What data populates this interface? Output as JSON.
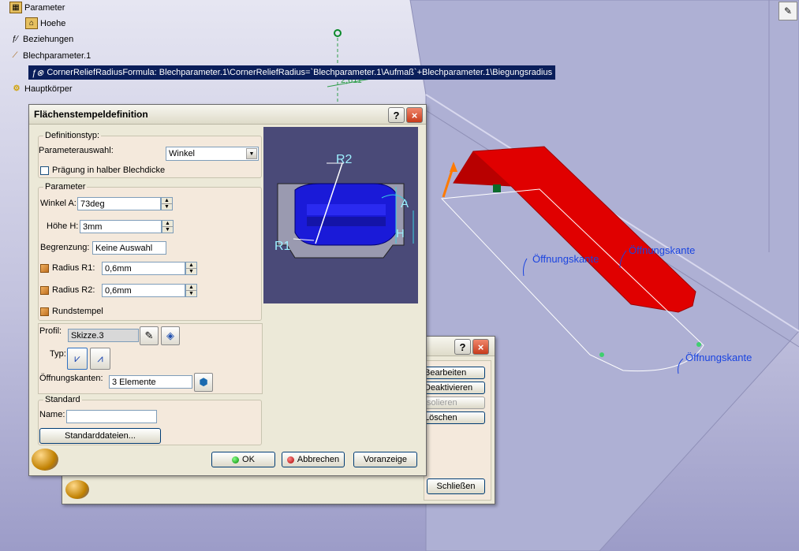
{
  "tree": {
    "items": [
      {
        "label": "Parameter",
        "icon": "parameter-icon"
      },
      {
        "label": "Hoehe",
        "icon": "parameter-value-icon"
      },
      {
        "label": "Beziehungen",
        "icon": "relations-icon"
      },
      {
        "label": "Blechparameter.1",
        "icon": "sheetmetal-params-icon"
      },
      {
        "label": "CornerReliefRadiusFormula: Blechparameter.1\\CornerReliefRadius=`Blechparameter.1\\Aufmaß`+Blechparameter.1\\Biegungsradius",
        "icon": "formula-icon"
      },
      {
        "label": "Hauptkörper",
        "icon": "partbody-icon"
      }
    ]
  },
  "viewport": {
    "dimension_text": "2,611",
    "annotations": [
      "Öffnungskante",
      "Öffnungskante",
      "Öffnungskante"
    ]
  },
  "dialog": {
    "title": "Flächenstempeldefinition",
    "definition": {
      "legend": "Definitionstyp:",
      "param_label": "Parameterauswahl:",
      "param_value": "Winkel",
      "half_thickness_label": "Prägung in halber Blechdicke"
    },
    "parameter": {
      "legend": "Parameter",
      "angle_label": "Winkel A:",
      "angle_value": "73deg",
      "height_label": "Höhe H:",
      "height_value": "3mm",
      "limit_label": "Begrenzung:",
      "limit_value": "Keine Auswahl",
      "r1_label": "Radius R1:",
      "r1_value": "0,6mm",
      "r2_label": "Radius R2:",
      "r2_value": "0,6mm",
      "round_label": "Rundstempel"
    },
    "profile": {
      "profile_label": "Profil:",
      "profile_value": "Skizze.3",
      "type_label": "Typ:",
      "edges_label": "Öffnungskanten:",
      "edges_value": "3 Elemente"
    },
    "standard": {
      "legend": "Standard",
      "name_label": "Name:",
      "name_value": "",
      "files_button": "Standarddateien..."
    },
    "preview_labels": {
      "r2": "R2",
      "r1": "R1",
      "a": "A",
      "h": "H"
    },
    "buttons": {
      "ok": "OK",
      "cancel": "Abbrechen",
      "preview": "Voranzeige"
    },
    "help": "?",
    "close": "×"
  },
  "back_dialog": {
    "buttons": [
      "Bearbeiten",
      "Deaktivieren",
      "Isolieren",
      "Löschen"
    ],
    "close_button": "Schließen",
    "help": "?",
    "close": "×"
  },
  "colors": {
    "viewport_bg": "#c2c2de",
    "dialog_bg": "#ece9d8",
    "group_bg": "#f4e9dc",
    "red_solid": "#e00000",
    "annotation": "#1a44e0"
  }
}
